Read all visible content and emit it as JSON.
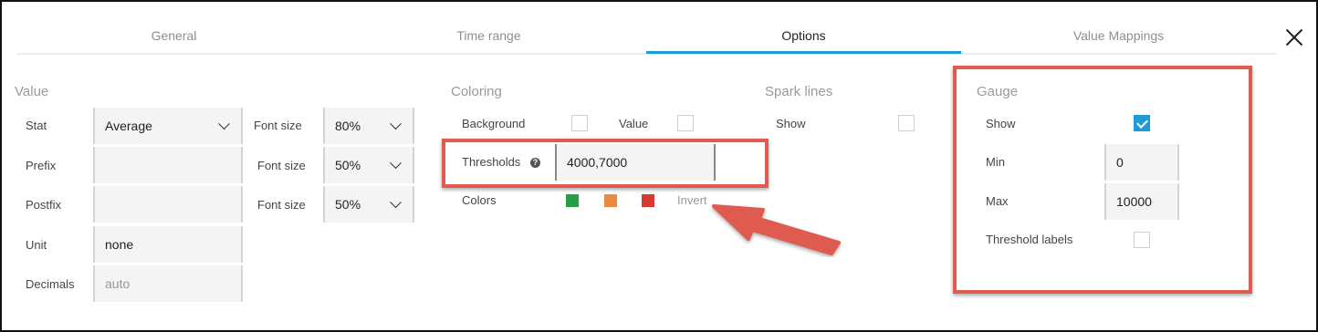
{
  "tabs": [
    "General",
    "Time range",
    "Options",
    "Value Mappings"
  ],
  "active_tab": "Options",
  "value_section": {
    "title": "Value",
    "stat_label": "Stat",
    "stat_value": "Average",
    "prefix_label": "Prefix",
    "prefix_value": "",
    "postfix_label": "Postfix",
    "postfix_value": "",
    "unit_label": "Unit",
    "unit_value": "none",
    "decimals_label": "Decimals",
    "decimals_placeholder": "auto",
    "font_sizes": [
      {
        "label": "Font size",
        "value": "80%"
      },
      {
        "label": "Font size",
        "value": "50%"
      },
      {
        "label": "Font size",
        "value": "50%"
      }
    ]
  },
  "coloring": {
    "title": "Coloring",
    "background_label": "Background",
    "background_checked": false,
    "value_label": "Value",
    "value_checked": false,
    "thresholds_label": "Thresholds",
    "thresholds_help_icon": "question-circle-icon",
    "thresholds_value": "4000,7000",
    "colors_label": "Colors",
    "colors": [
      "#27a045",
      "#ea8a3f",
      "#d83a33"
    ],
    "invert_label": "Invert"
  },
  "spark_lines": {
    "title": "Spark lines",
    "show_label": "Show",
    "show_checked": false
  },
  "gauge": {
    "title": "Gauge",
    "show_label": "Show",
    "show_checked": true,
    "min_label": "Min",
    "min_value": "0",
    "max_label": "Max",
    "max_value": "10000",
    "threshold_labels_label": "Threshold labels",
    "threshold_labels_checked": false
  },
  "colors": {
    "accent": "#1f9bd7",
    "highlight": "#e05b4f"
  },
  "close_icon": "close-icon"
}
